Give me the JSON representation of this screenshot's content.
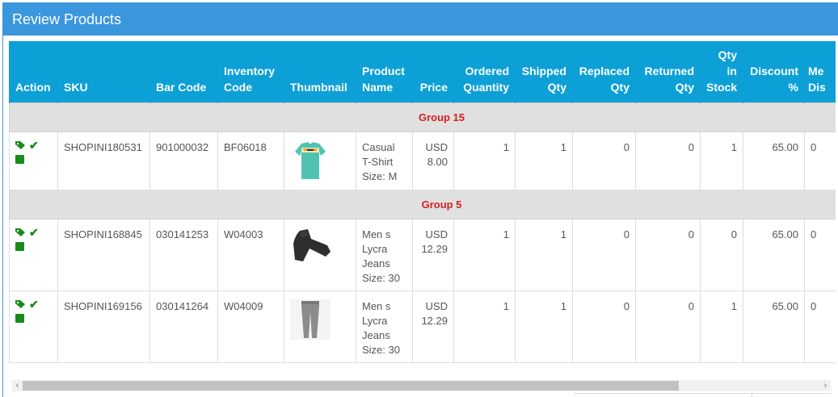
{
  "panel": {
    "title": "Review Products",
    "accent": "#3a96dd",
    "header_bg": "#0ca0d6"
  },
  "table": {
    "columns": [
      {
        "l1": "",
        "l2": "Action"
      },
      {
        "l1": "",
        "l2": "SKU"
      },
      {
        "l1": "",
        "l2": "Bar Code"
      },
      {
        "l1": "Inventory",
        "l2": "Code"
      },
      {
        "l1": "",
        "l2": "Thumbnail"
      },
      {
        "l1": "Product",
        "l2": "Name"
      },
      {
        "l1": "",
        "l2": "Price"
      },
      {
        "l1": "Ordered",
        "l2": "Quantity"
      },
      {
        "l1": "Shipped",
        "l2": "Qty"
      },
      {
        "l1": "Replaced",
        "l2": "Qty"
      },
      {
        "l1": "Returned",
        "l2": "Qty"
      },
      {
        "l1": "Qty",
        "l1b": "in",
        "l2": "Stock"
      },
      {
        "l1": "Discount",
        "l2": "%"
      },
      {
        "l1": "Me",
        "l2": "Dis"
      }
    ],
    "groups": [
      {
        "label": "Group 15",
        "rows": [
          {
            "sku": "SHOPINI180531",
            "barcode": "901000032",
            "inventory": "BF06018",
            "thumb_icon": "tshirt-thumbnail",
            "name": [
              "Casual",
              "T-Shirt",
              "Size: M"
            ],
            "price": [
              "USD",
              "8.00"
            ],
            "ordered": "1",
            "shipped": "1",
            "replaced": "0",
            "returned": "0",
            "stock": "1",
            "discount": "65.00",
            "last": "0"
          }
        ]
      },
      {
        "label": "Group 5",
        "rows": [
          {
            "sku": "SHOPINI168845",
            "barcode": "030141253",
            "inventory": "W04003",
            "thumb_icon": "jeans-thumbnail",
            "name": [
              "Men s",
              "Lycra",
              "Jeans",
              "Size: 30"
            ],
            "price": [
              "USD",
              "12.29"
            ],
            "ordered": "1",
            "shipped": "1",
            "replaced": "0",
            "returned": "0",
            "stock": "0",
            "discount": "65.00",
            "last": "0"
          },
          {
            "sku": "SHOPINI169156",
            "barcode": "030141264",
            "inventory": "W04009",
            "thumb_icon": "jeans-thumbnail",
            "name": [
              "Men s",
              "Lycra",
              "Jeans",
              "Size: 30"
            ],
            "price": [
              "USD",
              "12.29"
            ],
            "ordered": "1",
            "shipped": "1",
            "replaced": "0",
            "returned": "0",
            "stock": "1",
            "discount": "65.00",
            "last": "0"
          }
        ]
      }
    ]
  }
}
